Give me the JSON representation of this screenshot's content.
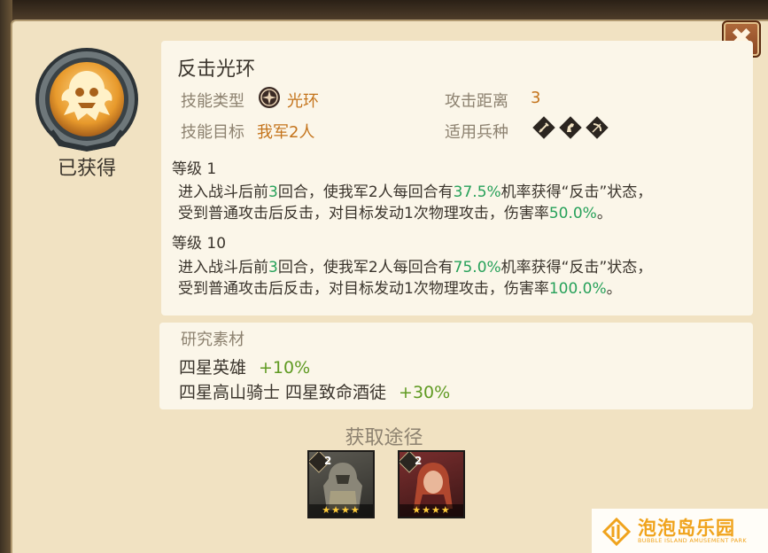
{
  "skill": {
    "name": "反击光环",
    "status": "已获得",
    "type_label": "技能类型",
    "type_value": "光环",
    "target_label": "技能目标",
    "target_value": "我军2人",
    "range_label": "攻击距离",
    "range_value": "3",
    "troop_label": "适用兵种",
    "troop_icons": [
      "sword-icon",
      "horse-icon",
      "bow-icon"
    ]
  },
  "levels": [
    {
      "label": "等级 1",
      "line1": [
        "进入战斗后前",
        "3",
        "回合，使我军2人每回合有",
        "37.5%",
        "机率获得“反击”状态，"
      ],
      "line2": [
        "受到普通攻击后反击，对目标发动1次物理攻击，伤害率",
        "50.0%",
        "。"
      ]
    },
    {
      "label": "等级 10",
      "line1": [
        "进入战斗后前",
        "3",
        "回合，使我军2人每回合有",
        "75.0%",
        "机率获得“反击”状态，"
      ],
      "line2": [
        "受到普通攻击后反击，对目标发动1次物理攻击，伤害率",
        "100.0%",
        "。"
      ]
    }
  ],
  "research": {
    "title": "研究素材",
    "items": [
      {
        "name": "四星英雄",
        "bonus": "+10%"
      },
      {
        "name": "四星高山骑士 四星致命酒徒",
        "bonus": "+30%"
      }
    ]
  },
  "sources": {
    "title": "获取途径",
    "heroes": [
      {
        "badge": "2",
        "stars": "★★★★",
        "colors": [
          "#4b4a44",
          "#2f2e2a"
        ]
      },
      {
        "badge": "2",
        "stars": "★★★★",
        "colors": [
          "#6b2a2a",
          "#3a1616"
        ]
      }
    ]
  },
  "watermark": {
    "name": "泡泡岛乐园",
    "subtitle": "BUBBLE ISLAND AMUSEMENT PARK"
  },
  "colors": {
    "highlight_green": "#27a15a",
    "value_orange": "#c4741c",
    "bonus_green": "#5f9a22"
  }
}
